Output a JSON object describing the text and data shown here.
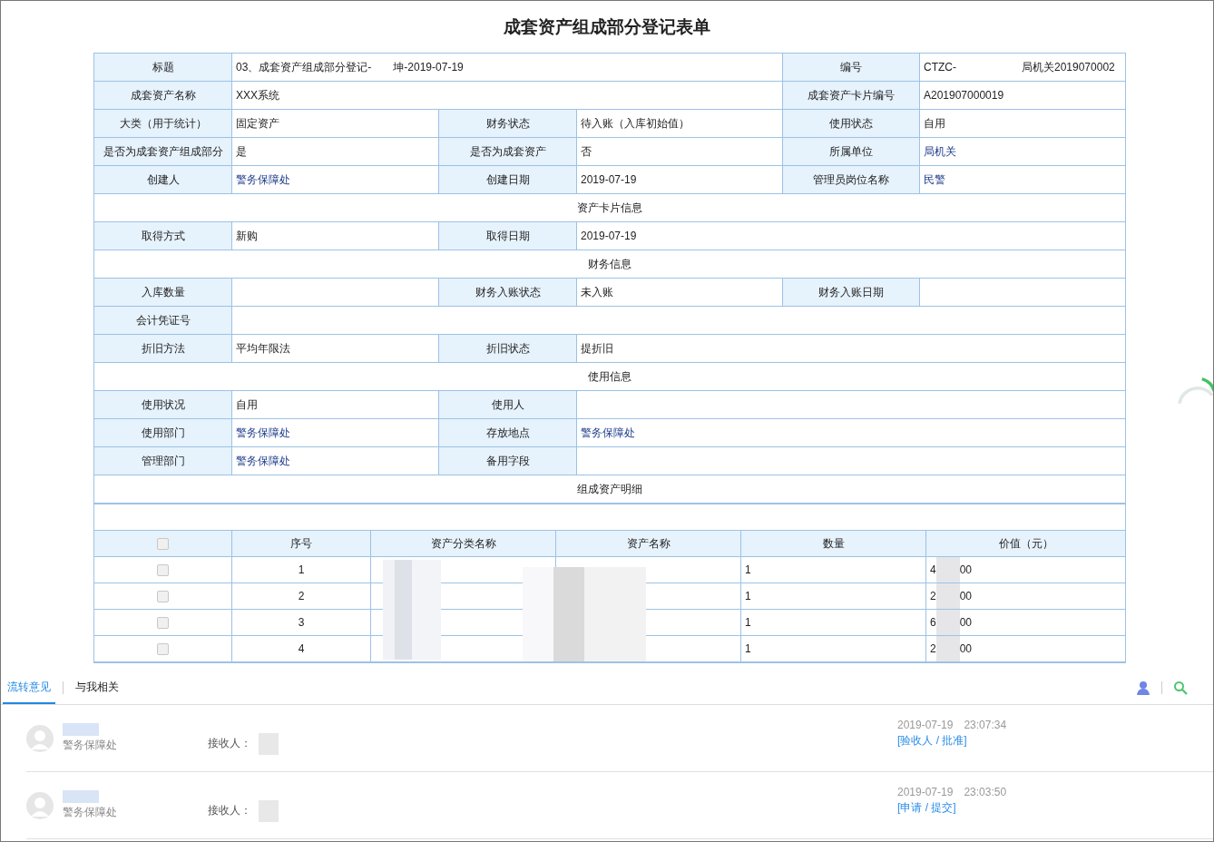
{
  "page": {
    "title": "成套资产组成部分登记表单"
  },
  "form": {
    "rows": [
      {
        "cells": [
          {
            "kind": "label",
            "text": "标题"
          },
          {
            "kind": "wide_value",
            "text": "03、成套资产组成部分登记-　　坤-2019-07-19"
          },
          {
            "kind": "label",
            "text": "编号"
          },
          {
            "kind": "value",
            "text": "CTZC-　　　　　　局机关2019070002"
          }
        ]
      },
      {
        "cells": [
          {
            "kind": "label",
            "text": "成套资产名称"
          },
          {
            "kind": "wide_value",
            "text": "XXX系统"
          },
          {
            "kind": "label",
            "text": "成套资产卡片编号"
          },
          {
            "kind": "value",
            "text": "A201907000019"
          }
        ]
      },
      {
        "cells": [
          {
            "kind": "label",
            "text": "大类（用于统计）"
          },
          {
            "kind": "value",
            "text": "固定资产"
          },
          {
            "kind": "label",
            "text": "财务状态"
          },
          {
            "kind": "value",
            "text": "待入账（入库初始值）"
          },
          {
            "kind": "label",
            "text": "使用状态"
          },
          {
            "kind": "value",
            "text": "自用"
          }
        ]
      },
      {
        "cells": [
          {
            "kind": "label",
            "text": "是否为成套资产组成部分"
          },
          {
            "kind": "value",
            "text": "是"
          },
          {
            "kind": "label",
            "text": "是否为成套资产"
          },
          {
            "kind": "value",
            "text": "否"
          },
          {
            "kind": "label",
            "text": "所属单位"
          },
          {
            "kind": "link",
            "text": "局机关"
          }
        ]
      },
      {
        "cells": [
          {
            "kind": "label",
            "text": "创建人"
          },
          {
            "kind": "link",
            "text": "警务保障处"
          },
          {
            "kind": "label",
            "text": "创建日期"
          },
          {
            "kind": "value",
            "text": "2019-07-19"
          },
          {
            "kind": "label",
            "text": "管理员岗位名称"
          },
          {
            "kind": "link",
            "text": "民警"
          }
        ]
      },
      {
        "cells": [
          {
            "kind": "section",
            "text": "资产卡片信息"
          }
        ]
      },
      {
        "cells": [
          {
            "kind": "label",
            "text": "取得方式"
          },
          {
            "kind": "value",
            "text": "新购"
          },
          {
            "kind": "label",
            "text": "取得日期"
          },
          {
            "kind": "wide_value",
            "text": "2019-07-19"
          }
        ]
      },
      {
        "cells": [
          {
            "kind": "section",
            "text": "财务信息"
          }
        ]
      },
      {
        "cells": [
          {
            "kind": "label",
            "text": "入库数量"
          },
          {
            "kind": "value"
          },
          {
            "kind": "label",
            "text": "财务入账状态"
          },
          {
            "kind": "value",
            "text": "未入账"
          },
          {
            "kind": "label",
            "text": "财务入账日期"
          },
          {
            "kind": "value"
          }
        ]
      },
      {
        "cells": [
          {
            "kind": "label",
            "text": "会计凭证号"
          },
          {
            "kind": "full_value"
          }
        ]
      },
      {
        "cells": [
          {
            "kind": "label",
            "text": "折旧方法"
          },
          {
            "kind": "value",
            "text": "平均年限法"
          },
          {
            "kind": "label",
            "text": "折旧状态"
          },
          {
            "kind": "wide_value",
            "text": "提折旧"
          }
        ]
      },
      {
        "cells": [
          {
            "kind": "section",
            "text": "使用信息"
          }
        ]
      },
      {
        "cells": [
          {
            "kind": "label",
            "text": "使用状况"
          },
          {
            "kind": "value",
            "text": "自用"
          },
          {
            "kind": "label",
            "text": "使用人"
          },
          {
            "kind": "wide_value"
          }
        ]
      },
      {
        "cells": [
          {
            "kind": "label",
            "text": "使用部门"
          },
          {
            "kind": "link",
            "text": "警务保障处"
          },
          {
            "kind": "label",
            "text": "存放地点"
          },
          {
            "kind": "wide_link",
            "text": "警务保障处"
          }
        ]
      },
      {
        "cells": [
          {
            "kind": "label",
            "text": "管理部门"
          },
          {
            "kind": "link",
            "text": "警务保障处"
          },
          {
            "kind": "label",
            "text": "备用字段"
          },
          {
            "kind": "wide_value"
          }
        ]
      },
      {
        "cells": [
          {
            "kind": "section",
            "text": "组成资产明细"
          }
        ]
      }
    ]
  },
  "details": {
    "header_checked": false,
    "columns": [
      "序号",
      "资产分类名称",
      "资产名称",
      "数量",
      "价值（元）"
    ],
    "rows": [
      {
        "checked": false,
        "index": "1",
        "quantity": "1",
        "value_start": "4",
        "value_end": "00"
      },
      {
        "checked": false,
        "index": "2",
        "quantity": "1",
        "value_start": "2",
        "value_end": "00"
      },
      {
        "checked": false,
        "index": "3",
        "quantity": "1",
        "value_start": "6",
        "value_end": "00"
      },
      {
        "checked": false,
        "index": "4",
        "quantity": "1",
        "value_start": "2",
        "value_end": "00"
      }
    ]
  },
  "tabs": [
    {
      "label": "流转意见",
      "selected": true
    },
    {
      "label": "与我相关",
      "selected": false
    }
  ],
  "comments": [
    {
      "department": "警务保障处",
      "receiver_label": "接收人：",
      "time": "2019-07-19　23:07:34",
      "action": "[验收人 / 批准]"
    },
    {
      "department": "警务保障处",
      "receiver_label": "接收人：",
      "time": "2019-07-19　23:03:50",
      "action": "[申请 / 提交]"
    }
  ]
}
